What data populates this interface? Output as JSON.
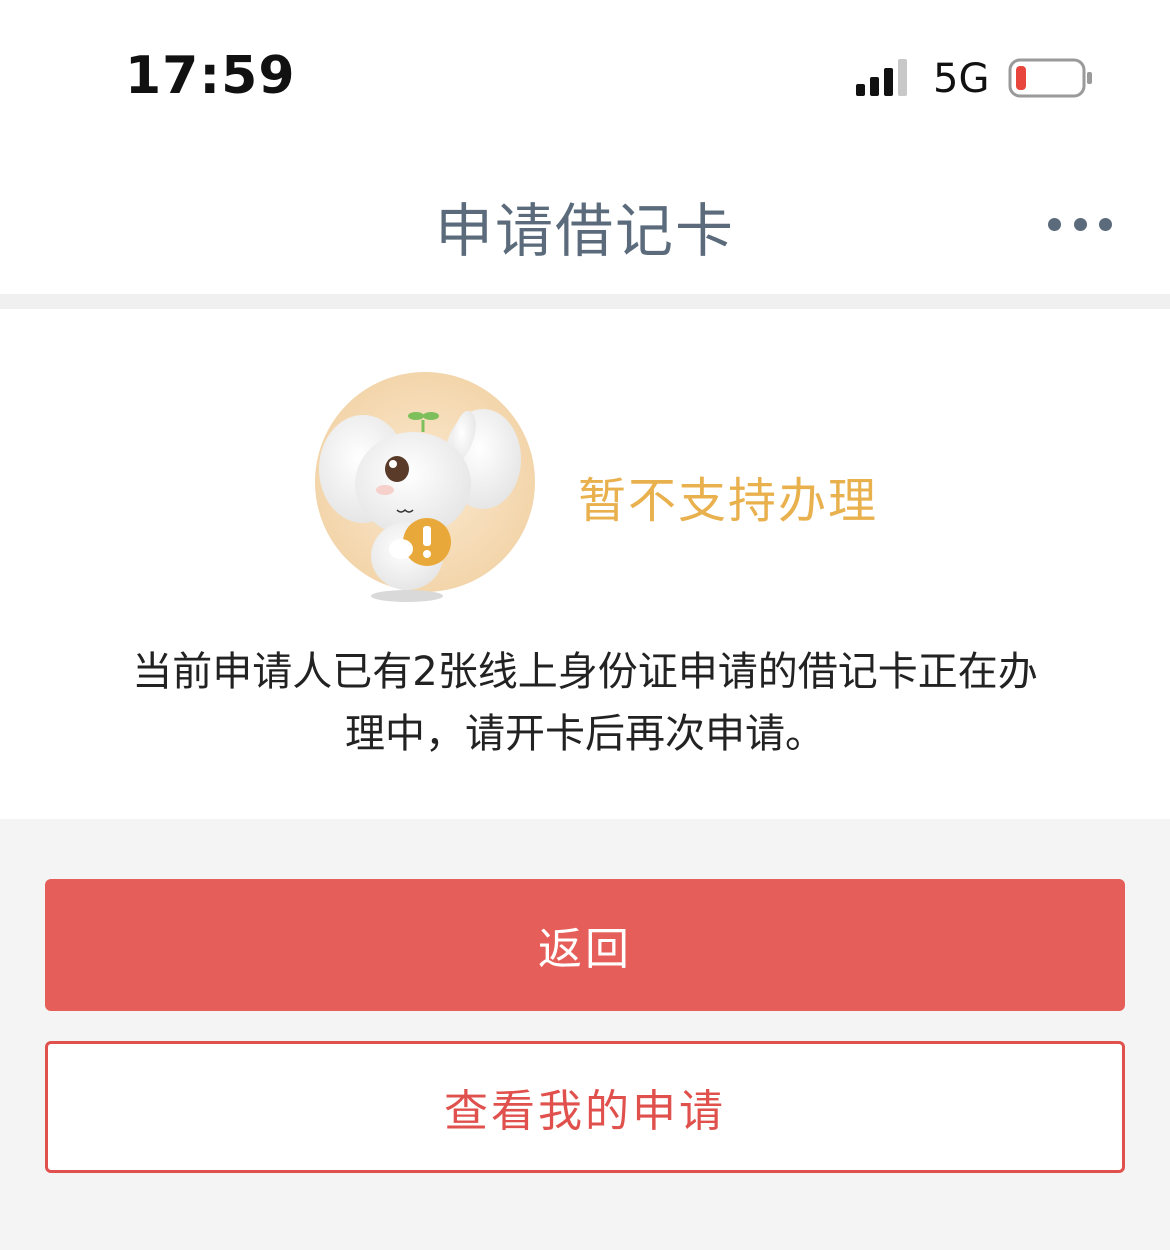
{
  "status_bar": {
    "time": "17:59",
    "network": "5G",
    "battery_level": 0.08,
    "battery_color": "#e8453c",
    "signal_bars_active": 3
  },
  "nav": {
    "title": "申请借记卡",
    "more_icon": "ellipsis-icon"
  },
  "result": {
    "mascot_icon": "elephant-warning-illustration",
    "title": "暂不支持办理",
    "message_line1": "当前申请人已有2张线上身份证申请的借记卡正在办",
    "message_line2": "理中，请开卡后再次申请。"
  },
  "actions": {
    "back_label": "返回",
    "view_label": "查看我的申请"
  },
  "colors": {
    "accent": "#e65e59",
    "warning_text": "#e9b04e",
    "nav_text": "#5b6b7c"
  }
}
